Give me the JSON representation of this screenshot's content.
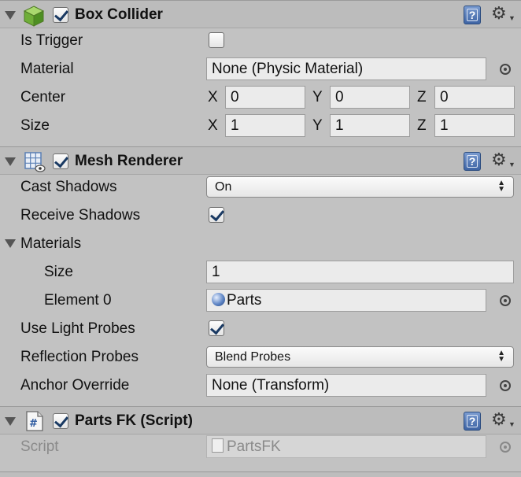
{
  "box_collider": {
    "title": "Box Collider",
    "enabled": true,
    "is_trigger": {
      "label": "Is Trigger",
      "checked": false
    },
    "material": {
      "label": "Material",
      "value": "None (Physic Material)"
    },
    "center": {
      "label": "Center",
      "x_label": "X",
      "y_label": "Y",
      "z_label": "Z",
      "x": "0",
      "y": "0",
      "z": "0"
    },
    "size": {
      "label": "Size",
      "x_label": "X",
      "y_label": "Y",
      "z_label": "Z",
      "x": "1",
      "y": "1",
      "z": "1"
    }
  },
  "mesh_renderer": {
    "title": "Mesh Renderer",
    "enabled": true,
    "cast_shadows": {
      "label": "Cast Shadows",
      "value": "On"
    },
    "receive_shadows": {
      "label": "Receive Shadows",
      "checked": true
    },
    "materials": {
      "label": "Materials",
      "size_label": "Size",
      "size_value": "1",
      "element0_label": "Element 0",
      "element0_value": "Parts"
    },
    "use_light_probes": {
      "label": "Use Light Probes",
      "checked": true
    },
    "reflection_probes": {
      "label": "Reflection Probes",
      "value": "Blend Probes"
    },
    "anchor_override": {
      "label": "Anchor Override",
      "value": "None (Transform)"
    }
  },
  "parts_fk": {
    "title": "Parts FK (Script)",
    "enabled": true,
    "script": {
      "label": "Script",
      "value": "PartsFK"
    }
  },
  "icons": {
    "help": "help-book-icon",
    "settings": "gear-icon",
    "box_collider": "green-cube-icon",
    "mesh_renderer": "mesh-grid-icon",
    "script": "csharp-script-icon"
  },
  "colors": {
    "background": "#c2c2c2",
    "field": "#ebebeb",
    "checkmark": "#1a3a63",
    "help_blue": "#3e64a4"
  }
}
